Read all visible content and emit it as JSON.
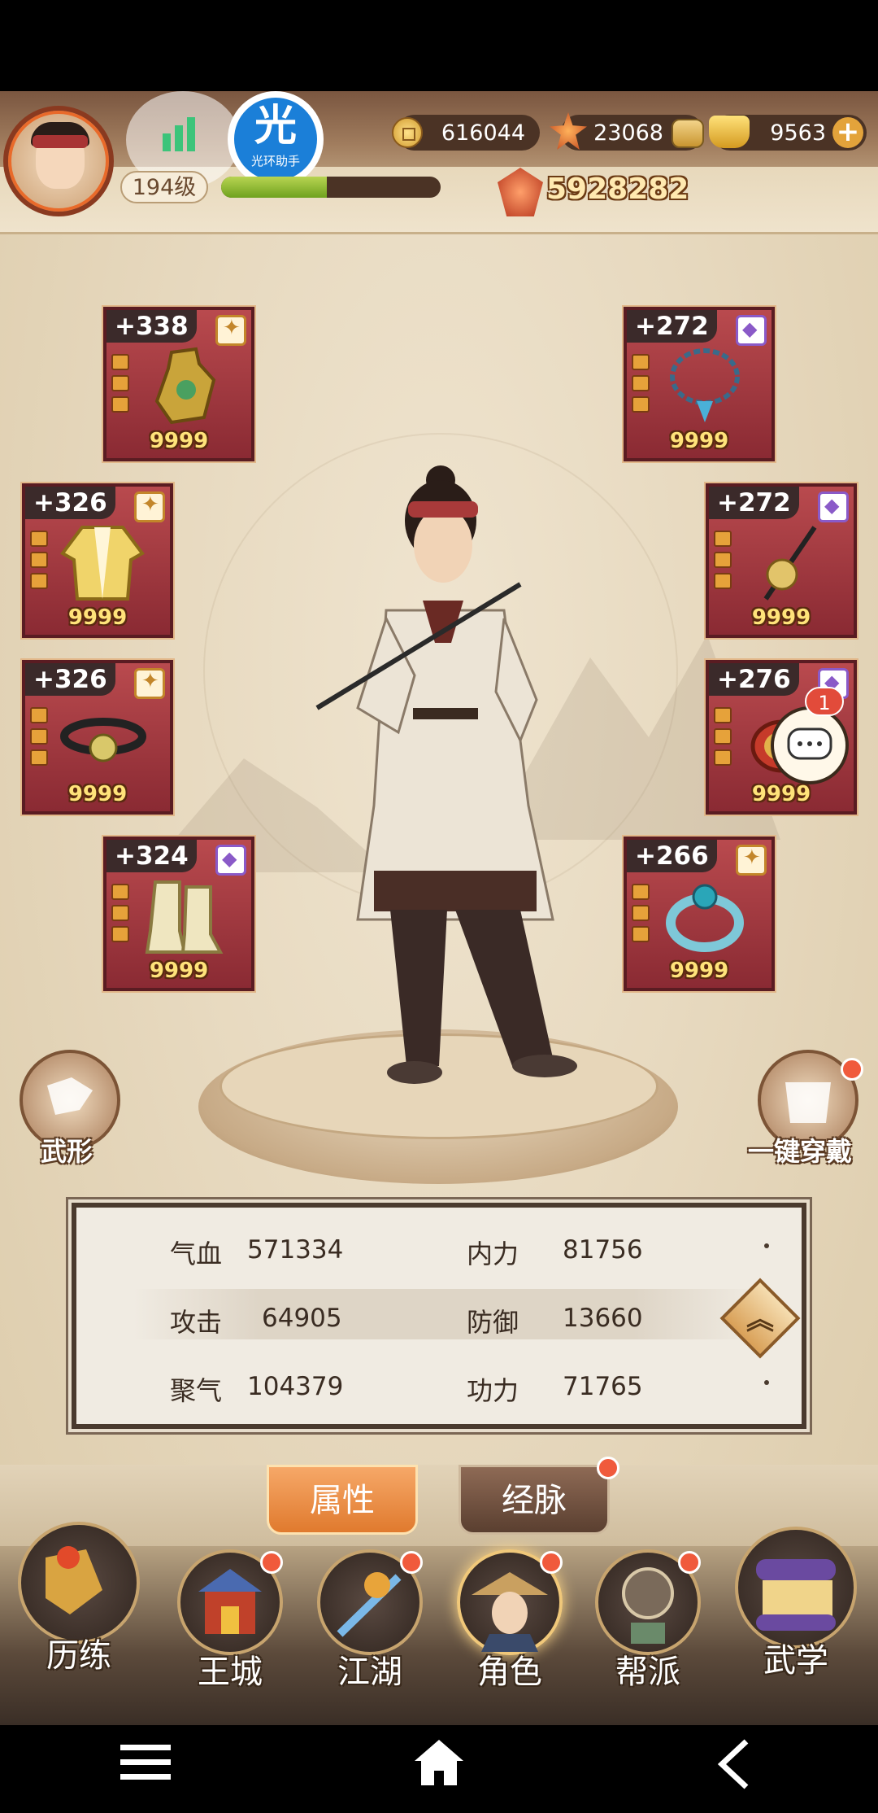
{
  "resources": {
    "copper": "616044",
    "gem": "23068",
    "ingot": "9563"
  },
  "player": {
    "level": "194级",
    "name_partial": "",
    "exp_fraction": 0.48,
    "combat_power": "5928282"
  },
  "overlay": {
    "helper_char": "光",
    "helper_label": "光环助手"
  },
  "equipment": {
    "left": [
      {
        "plus": "+338",
        "grade": "gold",
        "count": "9999",
        "icon": "vase-icon"
      },
      {
        "plus": "+326",
        "grade": "gold",
        "count": "9999",
        "icon": "robe-icon"
      },
      {
        "plus": "+326",
        "grade": "gold",
        "count": "9999",
        "icon": "belt-icon"
      },
      {
        "plus": "+324",
        "grade": "purple",
        "count": "9999",
        "icon": "boots-icon"
      }
    ],
    "right": [
      {
        "plus": "+272",
        "grade": "purple",
        "count": "9999",
        "icon": "necklace-icon"
      },
      {
        "plus": "+272",
        "grade": "purple",
        "count": "9999",
        "icon": "hairpin-icon"
      },
      {
        "plus": "+276",
        "grade": "purple",
        "count": "9999",
        "icon": "bracer-icon"
      },
      {
        "plus": "+266",
        "grade": "gold",
        "count": "9999",
        "icon": "ring-icon"
      }
    ]
  },
  "side_buttons": {
    "left_label": "武形",
    "right_label": "一键穿戴"
  },
  "chat": {
    "badge": "1"
  },
  "stats": [
    {
      "label": "气血",
      "value": "571334"
    },
    {
      "label": "内力",
      "value": "81756"
    },
    {
      "label": "攻击",
      "value": "64905"
    },
    {
      "label": "防御",
      "value": "13660"
    },
    {
      "label": "聚气",
      "value": "104379"
    },
    {
      "label": "功力",
      "value": "71765"
    }
  ],
  "tabs": {
    "attributes": "属性",
    "meridians": "经脉"
  },
  "nav": [
    {
      "label": "历练",
      "icon": "training-icon"
    },
    {
      "label": "王城",
      "icon": "city-gate-icon"
    },
    {
      "label": "江湖",
      "icon": "sword-icon"
    },
    {
      "label": "角色",
      "icon": "character-icon"
    },
    {
      "label": "帮派",
      "icon": "guild-icon"
    },
    {
      "label": "武学",
      "icon": "scroll-icon"
    }
  ],
  "colors": {
    "slot_red": "#9e3a40",
    "accent_orange": "#e07a2e",
    "panel_border": "#4a3a2e"
  }
}
